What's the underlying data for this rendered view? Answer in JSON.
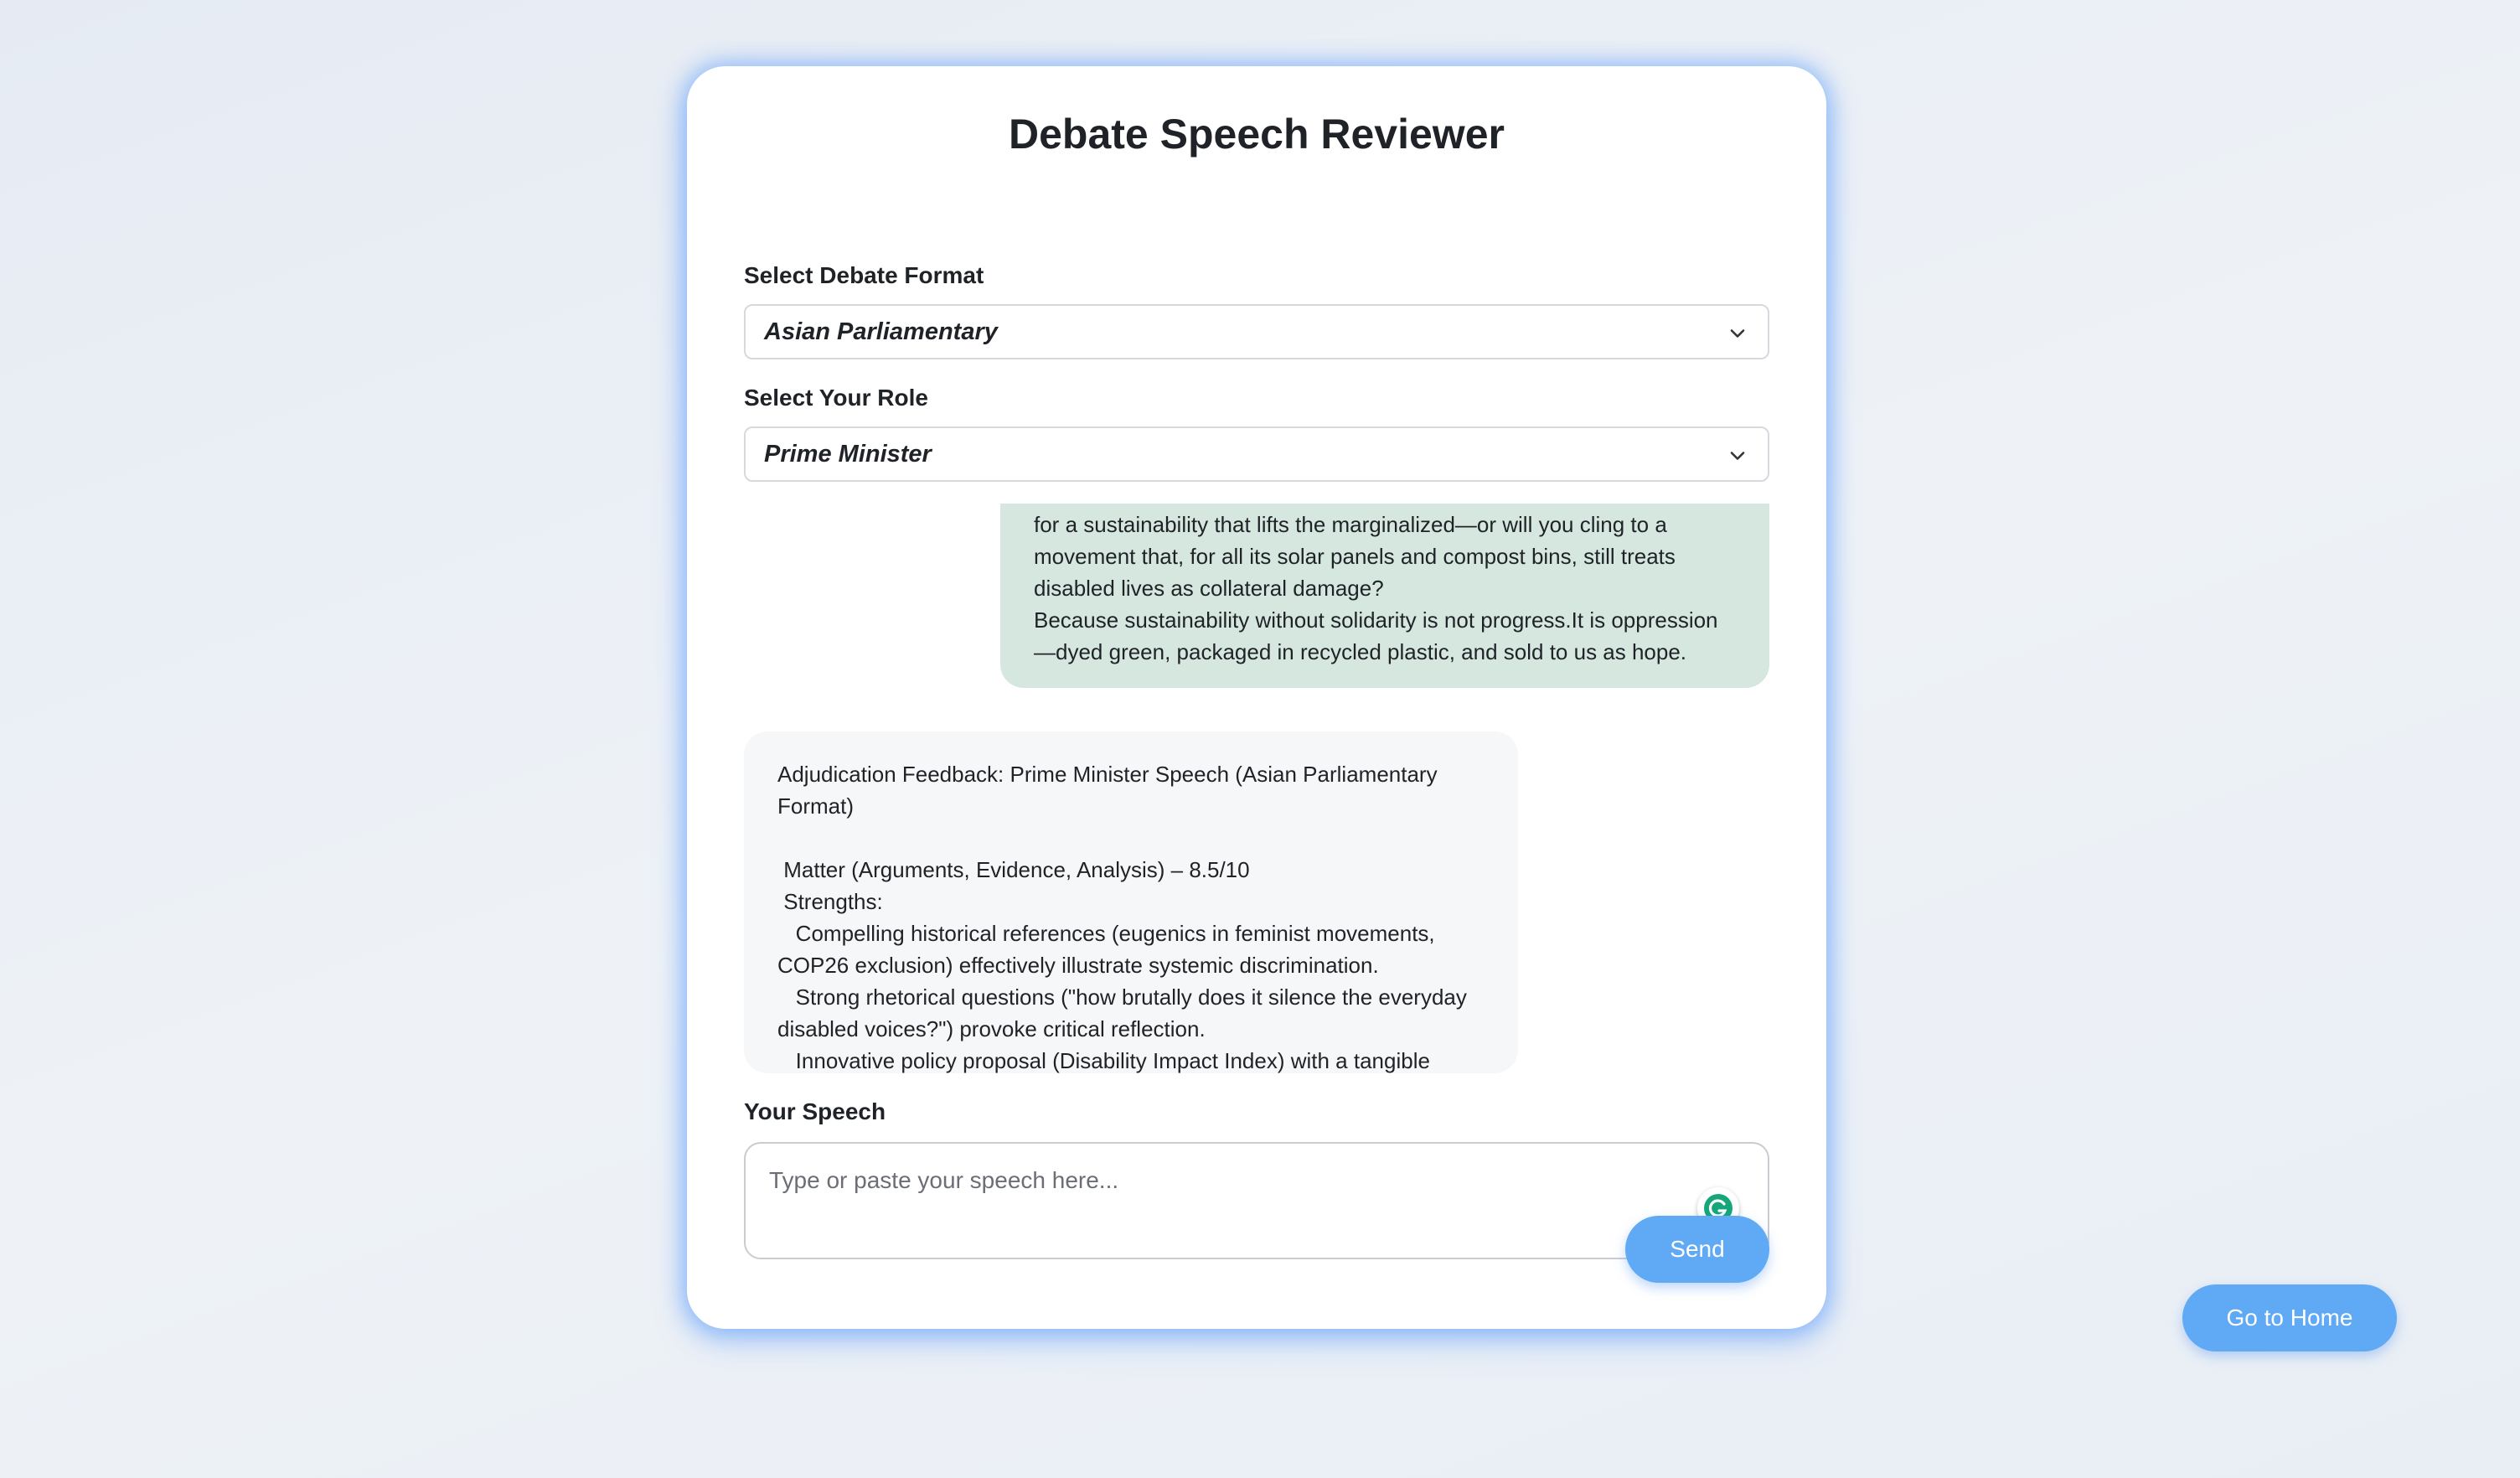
{
  "app": {
    "title": "Debate Speech Reviewer"
  },
  "format": {
    "label": "Select Debate Format",
    "selected": "Asian Parliamentary"
  },
  "role": {
    "label": "Select Your Role",
    "selected": "Prime Minister"
  },
  "chat": {
    "user_message": "for a sustainability that lifts the marginalized—or will you cling to a\nmovement that, for all its solar panels and compost bins, still treats\ndisabled lives as collateral damage?\nBecause sustainability without solidarity is not progress.It is oppression\n—dyed green, packaged in recycled plastic, and sold to us as hope.",
    "feedback_message": "Adjudication Feedback: Prime Minister Speech (Asian Parliamentary\nFormat)\n\n Matter (Arguments, Evidence, Analysis) – 8.5/10\n Strengths:\n   Compelling historical references (eugenics in feminist movements,\nCOP26 exclusion) effectively illustrate systemic discrimination.\n   Strong rhetorical questions (\"how brutally does it silence the everyday\ndisabled voices?\") provoke critical reflection.\n   Innovative policy proposal (Disability Impact Index) with a tangible"
  },
  "speech": {
    "label": "Your Speech",
    "placeholder": "Type or paste your speech here..."
  },
  "actions": {
    "send_label": "Send",
    "home_label": "Go to Home"
  },
  "colors": {
    "accent": "#5fa9f5",
    "user_bubble": "#d6e7df",
    "bot_bubble": "#f6f7f9"
  }
}
